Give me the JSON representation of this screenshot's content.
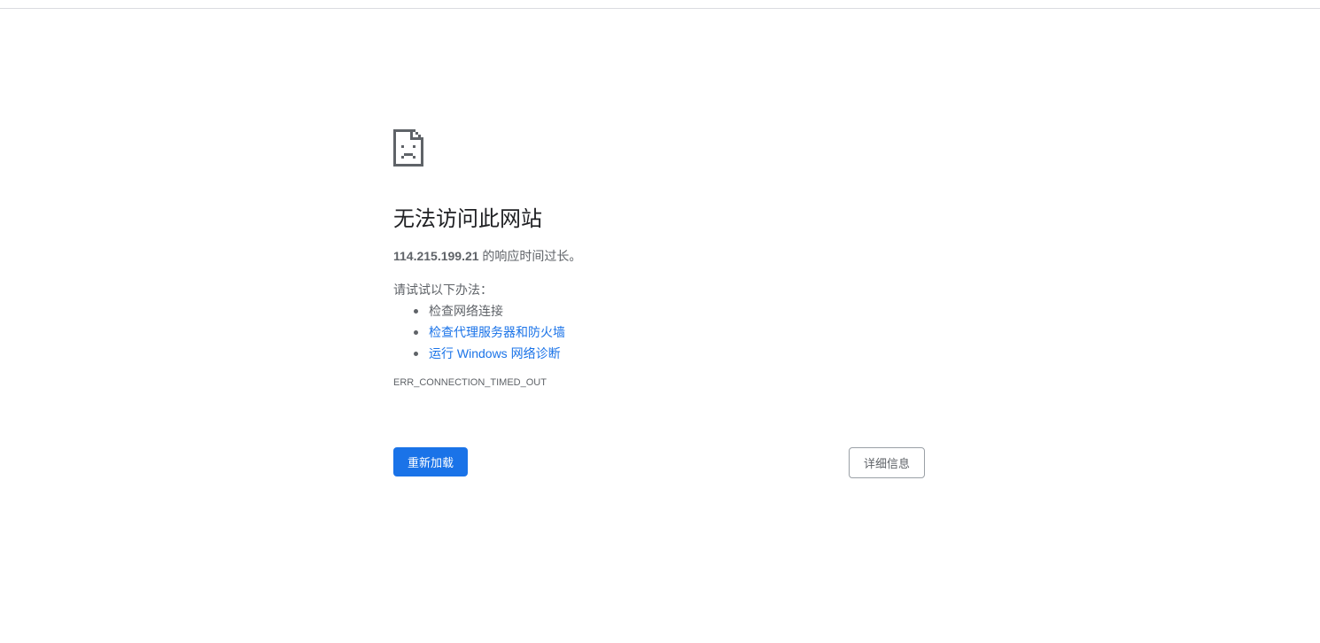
{
  "page": {
    "title": "无法访问此网站",
    "host": "114.215.199.21",
    "summary_suffix": " 的响应时间过长。",
    "try_label": "请试试以下办法：",
    "suggestions": [
      {
        "label": "检查网络连接",
        "is_link": false
      },
      {
        "label": "检查代理服务器和防火墙",
        "is_link": true
      },
      {
        "label": "运行 Windows 网络诊断",
        "is_link": true
      }
    ],
    "error_code": "ERR_CONNECTION_TIMED_OUT",
    "icon": "sad-page-icon"
  },
  "buttons": {
    "reload_label": "重新加载",
    "details_label": "详细信息"
  },
  "colors": {
    "accent": "#1a73e8",
    "text_primary": "#202124",
    "text_secondary": "#5f6368"
  }
}
